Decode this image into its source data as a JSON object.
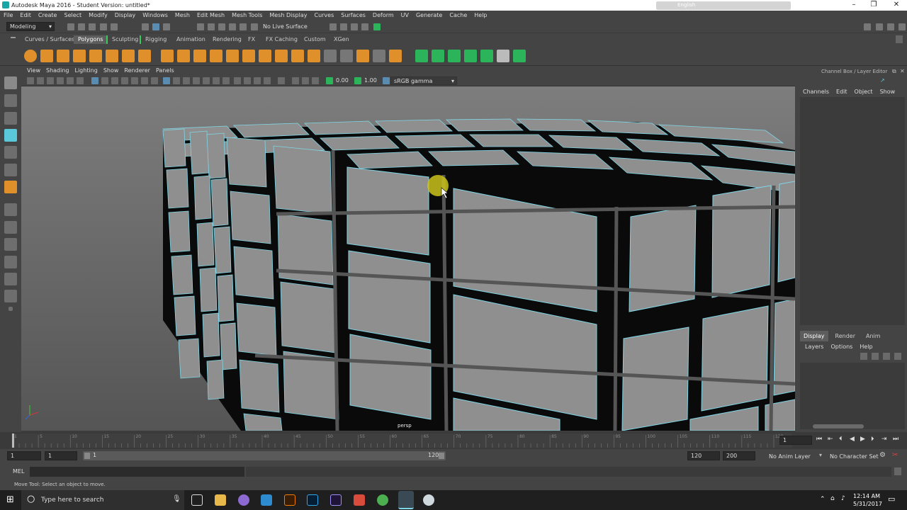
{
  "window": {
    "title": "Autodesk Maya 2016 - Student Version: untitled*",
    "ime_label": "English"
  },
  "menu": [
    "File",
    "Edit",
    "Create",
    "Select",
    "Modify",
    "Display",
    "Windows",
    "Mesh",
    "Edit Mesh",
    "Mesh Tools",
    "Mesh Display",
    "Curves",
    "Surfaces",
    "Deform",
    "UV",
    "Generate",
    "Cache",
    "Help"
  ],
  "status_line": {
    "mode": "Modeling",
    "live_surface": "No Live Surface"
  },
  "shelf_tabs": [
    "Curves / Surfaces",
    "Polygons",
    "Sculpting",
    "Rigging",
    "Animation",
    "Rendering",
    "FX",
    "FX Caching",
    "Custom",
    "XGen"
  ],
  "shelf_active_tab": "Polygons",
  "panel": {
    "menus": [
      "View",
      "Shading",
      "Lighting",
      "Show",
      "Renderer",
      "Panels"
    ],
    "exposure": "0.00",
    "gamma": "1.00",
    "color_space": "sRGB gamma",
    "camera_label": "persp"
  },
  "channel_box": {
    "title": "Channel Box / Layer Editor",
    "menus": [
      "Channels",
      "Edit",
      "Object",
      "Show"
    ],
    "layer_tabs": [
      "Display",
      "Render",
      "Anim"
    ],
    "layer_menus": [
      "Layers",
      "Options",
      "Help"
    ]
  },
  "timeline": {
    "ticks": [
      "1",
      "5",
      "10",
      "15",
      "20",
      "25",
      "30",
      "35",
      "40",
      "45",
      "50",
      "55",
      "60",
      "65",
      "70",
      "75",
      "80",
      "85",
      "90",
      "95",
      "100",
      "105",
      "110",
      "115",
      "120"
    ],
    "current_frame": "1"
  },
  "range": {
    "start": "1",
    "playback_start": "1",
    "slider_start": "1",
    "slider_end": "120",
    "playback_end": "120",
    "end": "200",
    "anim_layer": "No Anim Layer",
    "char_set": "No Character Set"
  },
  "mel_label": "MEL",
  "help_line": "Move Tool: Select an object to move.",
  "taskbar": {
    "search_placeholder": "Type here to search",
    "time": "12:14 AM",
    "date": "5/31/2017"
  },
  "colors": {
    "accent": "#5bc8d9",
    "wire": "#7fd6e6",
    "maya_teal": "#1ba6a6"
  }
}
